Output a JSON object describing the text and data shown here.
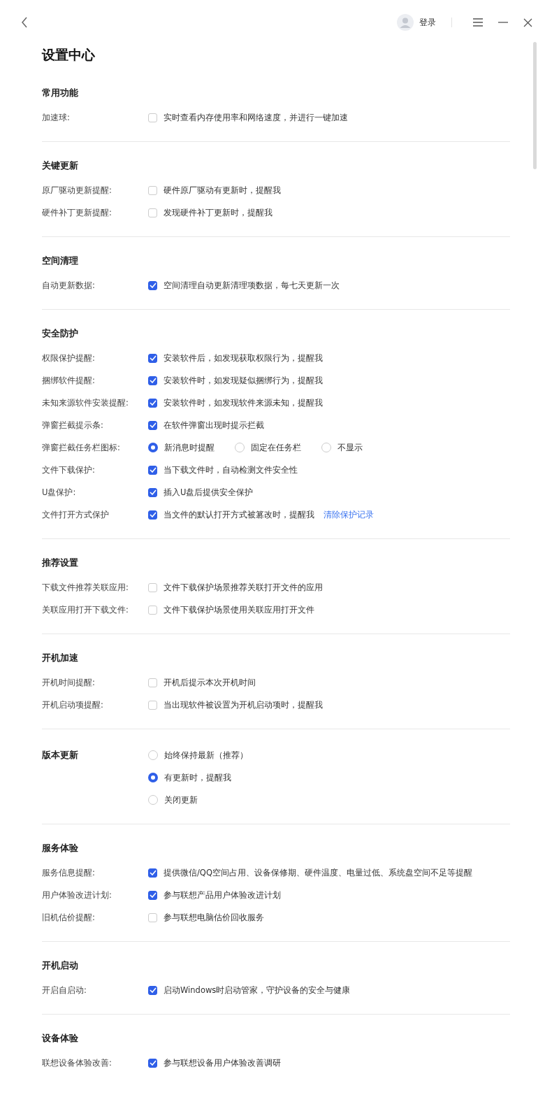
{
  "header": {
    "login": "登录"
  },
  "title": "设置中心",
  "sections": [
    {
      "title": "常用功能",
      "rows": [
        {
          "kind": "checkbox",
          "label": "加速球:",
          "checked": false,
          "text": "实时查看内存使用率和网络速度，并进行一键加速"
        }
      ]
    },
    {
      "title": "关键更新",
      "rows": [
        {
          "kind": "checkbox",
          "label": "原厂驱动更新提醒:",
          "checked": false,
          "text": "硬件原厂驱动有更新时，提醒我"
        },
        {
          "kind": "checkbox",
          "label": "硬件补丁更新提醒:",
          "checked": false,
          "text": "发现硬件补丁更新时，提醒我"
        }
      ]
    },
    {
      "title": "空间清理",
      "rows": [
        {
          "kind": "checkbox",
          "label": "自动更新数据:",
          "checked": true,
          "text": "空间清理自动更新清理项数据，每七天更新一次"
        }
      ]
    },
    {
      "title": "安全防护",
      "rows": [
        {
          "kind": "checkbox",
          "label": "权限保护提醒:",
          "checked": true,
          "text": "安装软件后，如发现获取权限行为，提醒我"
        },
        {
          "kind": "checkbox",
          "label": "捆绑软件提醒:",
          "checked": true,
          "text": "安装软件时，如发现疑似捆绑行为，提醒我"
        },
        {
          "kind": "checkbox",
          "label": "未知来源软件安装提醒:",
          "checked": true,
          "text": "安装软件时，如发现软件来源未知，提醒我"
        },
        {
          "kind": "checkbox",
          "label": "弹窗拦截提示条:",
          "checked": true,
          "text": "在软件弹窗出现时提示拦截"
        },
        {
          "kind": "radio",
          "label": "弹窗拦截任务栏图标:",
          "options": [
            {
              "label": "新消息时提醒",
              "selected": true
            },
            {
              "label": "固定在任务栏",
              "selected": false
            },
            {
              "label": "不显示",
              "selected": false
            }
          ]
        },
        {
          "kind": "checkbox",
          "label": "文件下载保护:",
          "checked": true,
          "text": "当下载文件时，自动检测文件安全性"
        },
        {
          "kind": "checkbox",
          "label": "U盘保护:",
          "checked": true,
          "text": "插入U盘后提供安全保护"
        },
        {
          "kind": "checkbox",
          "label": "文件打开方式保护",
          "checked": true,
          "text": "当文件的默认打开方式被篡改时，提醒我",
          "link": "清除保护记录"
        }
      ]
    },
    {
      "title": "推荐设置",
      "rows": [
        {
          "kind": "checkbox",
          "label": "下载文件推荐关联应用:",
          "checked": false,
          "text": "文件下载保护场景推荐关联打开文件的应用"
        },
        {
          "kind": "checkbox",
          "label": "关联应用打开下载文件:",
          "checked": false,
          "text": "文件下载保护场景使用关联应用打开文件"
        }
      ]
    },
    {
      "title": "开机加速",
      "rows": [
        {
          "kind": "checkbox",
          "label": "开机时间提醒:",
          "checked": false,
          "text": "开机后提示本次开机时间"
        },
        {
          "kind": "checkbox",
          "label": "开机启动项提醒:",
          "checked": false,
          "text": "当出现软件被设置为开机启动项时，提醒我"
        }
      ]
    },
    {
      "title": "版本更新",
      "kind": "radio_list",
      "options": [
        {
          "label": "始终保持最新（推荐）",
          "selected": false
        },
        {
          "label": "有更新时，提醒我",
          "selected": true
        },
        {
          "label": "关闭更新",
          "selected": false
        }
      ]
    },
    {
      "title": "服务体验",
      "rows": [
        {
          "kind": "checkbox",
          "label": "服务信息提醒:",
          "checked": true,
          "text": "提供微信/QQ空间占用、设备保修期、硬件温度、电量过低、系统盘空间不足等提醒"
        },
        {
          "kind": "checkbox",
          "label": "用户体验改进计划:",
          "checked": true,
          "text": "参与联想产品用户体验改进计划"
        },
        {
          "kind": "checkbox",
          "label": "旧机估价提醒:",
          "checked": false,
          "text": "参与联想电脑估价回收服务"
        }
      ]
    },
    {
      "title": "开机启动",
      "rows": [
        {
          "kind": "checkbox",
          "label": "开启自启动:",
          "checked": true,
          "text": "启动Windows时启动管家，守护设备的安全与健康"
        }
      ]
    },
    {
      "title": "设备体验",
      "rows": [
        {
          "kind": "checkbox",
          "label": "联想设备体验改善:",
          "checked": true,
          "text": "参与联想设备用户体验改善调研"
        }
      ]
    }
  ]
}
